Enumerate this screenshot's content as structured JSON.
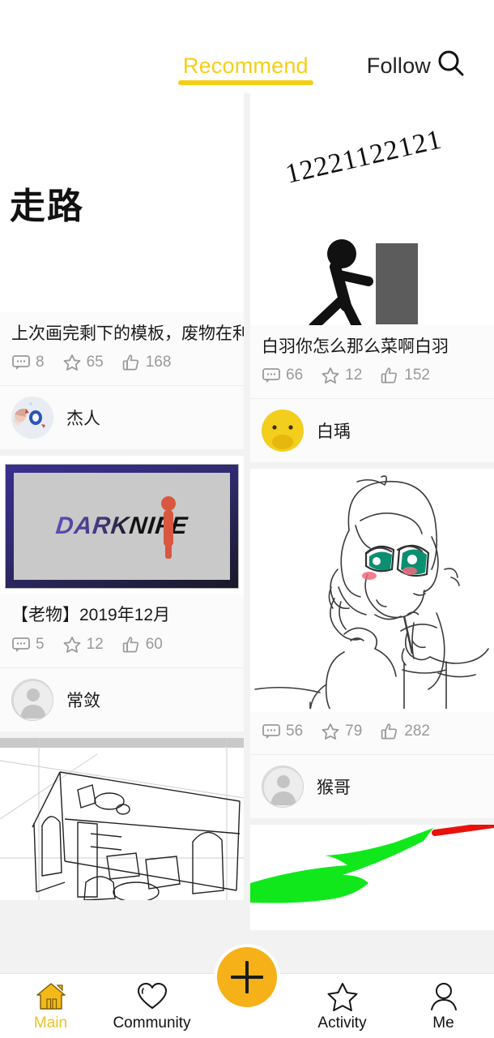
{
  "header": {
    "tabs": [
      {
        "label": "Recommend",
        "active": true
      },
      {
        "label": "Follow",
        "active": false
      }
    ],
    "search_icon": "search-icon"
  },
  "feed": {
    "left_column": [
      {
        "id": "card-walk",
        "media_kind": "drawing-walk",
        "media_text": "走路",
        "title": "上次画完剩下的模板，废物在利用了",
        "stats": {
          "comments": "8",
          "favorites": "65",
          "likes": "168"
        },
        "author": {
          "name": "杰人",
          "avatar_kind": "anime-avatar"
        }
      },
      {
        "id": "card-darknife",
        "media_kind": "darknife-banner",
        "media_text": "DARKNIFE",
        "title": "【老物】2019年12月",
        "stats": {
          "comments": "5",
          "favorites": "12",
          "likes": "60"
        },
        "author": {
          "name": "常敛",
          "avatar_kind": "generic-avatar"
        }
      },
      {
        "id": "card-room-sketch",
        "media_kind": "room-sketch",
        "media_text": "",
        "title": "",
        "stats": {
          "comments": "",
          "favorites": "",
          "likes": ""
        },
        "author": {
          "name": "",
          "avatar_kind": ""
        }
      }
    ],
    "right_column": [
      {
        "id": "card-stickman",
        "media_kind": "stickman",
        "media_text": "12221122121",
        "title": "白羽你怎么那么菜啊白羽",
        "stats": {
          "comments": "66",
          "favorites": "12",
          "likes": "152"
        },
        "author": {
          "name": "白瑀",
          "avatar_kind": "duck-avatar"
        }
      },
      {
        "id": "card-anime-girl",
        "media_kind": "anime-girl-lineart",
        "media_text": "",
        "title": "",
        "stats": {
          "comments": "56",
          "favorites": "79",
          "likes": "282"
        },
        "author": {
          "name": "猴哥",
          "avatar_kind": "generic-avatar"
        }
      },
      {
        "id": "card-green-arrow",
        "media_kind": "green-arrow",
        "media_text": "",
        "title": "",
        "stats": {
          "comments": "",
          "favorites": "",
          "likes": ""
        },
        "author": {
          "name": "",
          "avatar_kind": ""
        }
      }
    ]
  },
  "bottom_nav": {
    "items": [
      {
        "label": "Main",
        "icon": "home-icon",
        "active": true
      },
      {
        "label": "Community",
        "icon": "heart-icon",
        "active": false
      },
      {
        "label": "Activity",
        "icon": "star-icon",
        "active": false
      },
      {
        "label": "Me",
        "icon": "person-icon",
        "active": false
      }
    ],
    "fab": {
      "icon": "plus-icon",
      "label": ""
    }
  },
  "colors": {
    "accent_yellow": "#F5CE18",
    "fab_amber": "#F5B117",
    "page_bg": "#F2F2F2",
    "card_bg": "#FBFBFB",
    "stat_gray": "#9A9A9A",
    "text_dark": "#1A1A1A"
  }
}
